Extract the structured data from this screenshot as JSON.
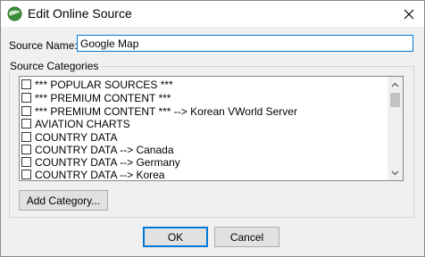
{
  "window": {
    "title": "Edit Online Source",
    "close_glyph": "✕"
  },
  "form": {
    "source_name_label": "Source Name:",
    "source_name_value": "Google Map"
  },
  "categories": {
    "legend": "Source Categories",
    "items": [
      {
        "label": "*** POPULAR SOURCES ***",
        "checked": false
      },
      {
        "label": "*** PREMIUM CONTENT ***",
        "checked": false
      },
      {
        "label": "*** PREMIUM CONTENT *** --> Korean VWorld Server",
        "checked": false
      },
      {
        "label": "AVIATION CHARTS",
        "checked": false
      },
      {
        "label": "COUNTRY DATA",
        "checked": false
      },
      {
        "label": "COUNTRY DATA --> Canada",
        "checked": false
      },
      {
        "label": "COUNTRY DATA --> Germany",
        "checked": false
      },
      {
        "label": "COUNTRY DATA --> Korea",
        "checked": false
      }
    ]
  },
  "buttons": {
    "add_category": "Add Category...",
    "ok": "OK",
    "cancel": "Cancel"
  },
  "colors": {
    "accent": "#0078d7",
    "icon_green": "#3a8f3a"
  }
}
